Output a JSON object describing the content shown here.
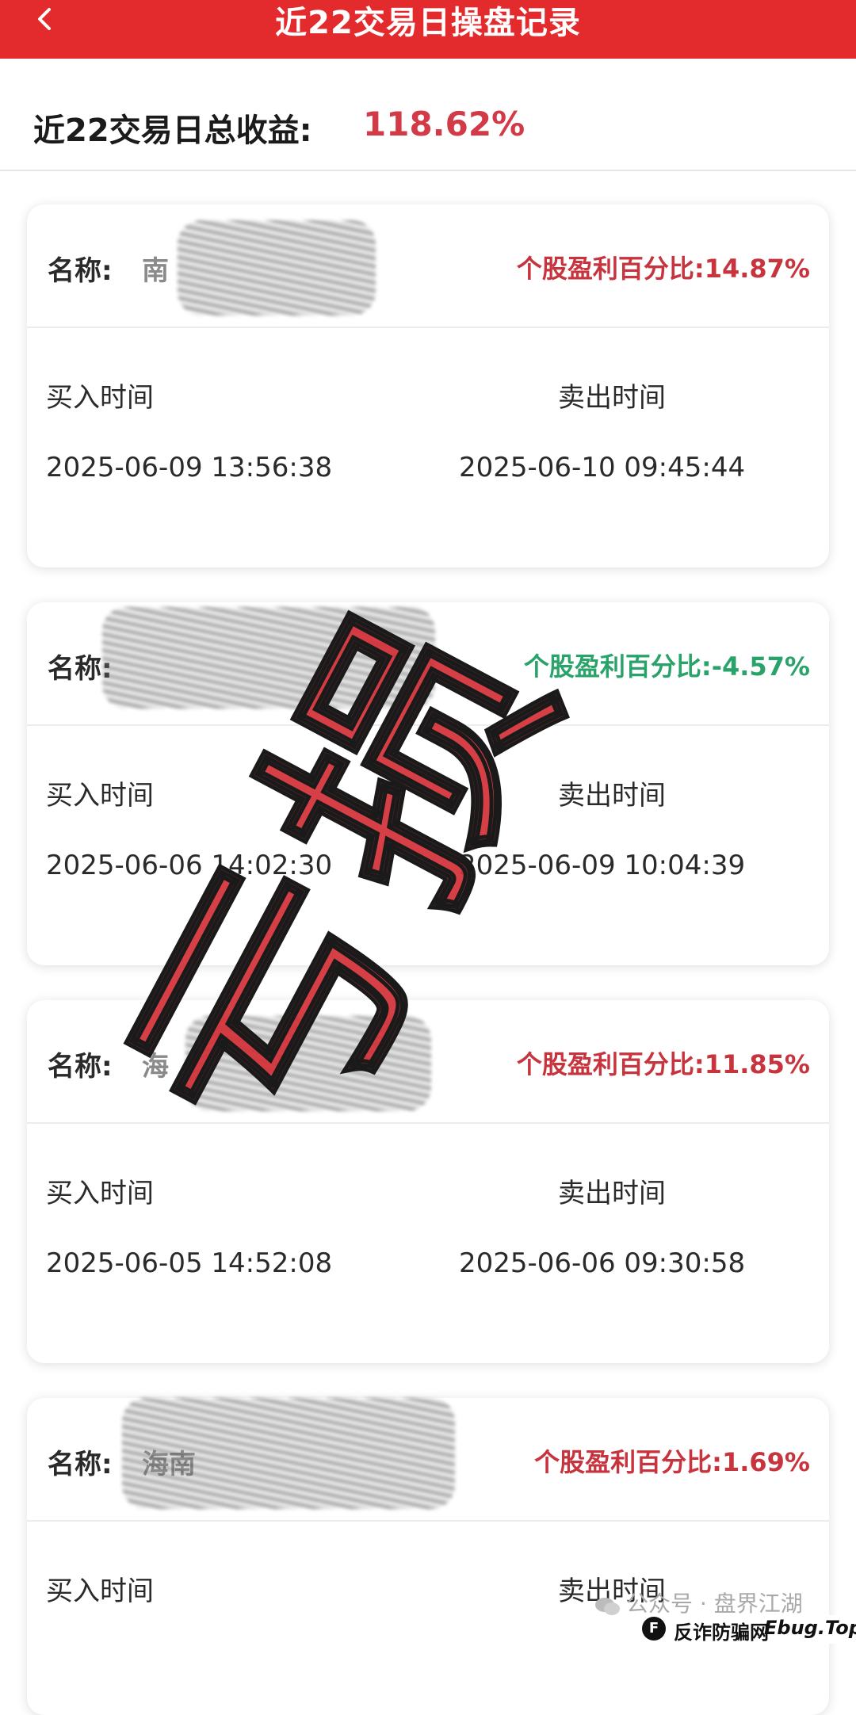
{
  "header": {
    "title": "近22交易日操盘记录",
    "back_icon": "chevron-left-icon",
    "background_color": "#e32b2e"
  },
  "summary": {
    "label": "近22交易日总收益:",
    "value": "118.62%",
    "value_color": "#d23a48"
  },
  "records": [
    {
      "name_label": "名称:",
      "name_value": "南",
      "pct_text": "个股盈利百分比:14.87%",
      "buy_label": "买入时间",
      "sell_label": "卖出时间",
      "buy_time": "2025-06-09 13:56:38",
      "sell_time": "2025-06-10 09:45:44"
    },
    {
      "name_label": "名称:",
      "name_value": "",
      "pct_text": "个股盈利百分比:-4.57%",
      "buy_label": "买入时间",
      "sell_label": "卖出时间",
      "buy_time": "2025-06-06 14:02:30",
      "sell_time": "2025-06-09 10:04:39"
    },
    {
      "name_label": "名称:",
      "name_value": "海",
      "pct_text": "个股盈利百分比:11.85%",
      "buy_label": "买入时间",
      "sell_label": "卖出时间",
      "buy_time": "2025-06-05 14:52:08",
      "sell_time": "2025-06-06 09:30:58"
    },
    {
      "name_label": "名称:",
      "name_value": "海南",
      "pct_text": "个股盈利百分比:1.69%",
      "buy_label": "买入时间",
      "sell_label": "卖出时间",
      "buy_time": "",
      "sell_time": ""
    }
  ],
  "stamp": {
    "text": "亏损",
    "color": "#d22f36"
  },
  "watermark": {
    "text": "公众号 · 盘界江湖"
  },
  "footer": {
    "site_name": "反诈防骗网",
    "domain": "Ebug.Top"
  }
}
